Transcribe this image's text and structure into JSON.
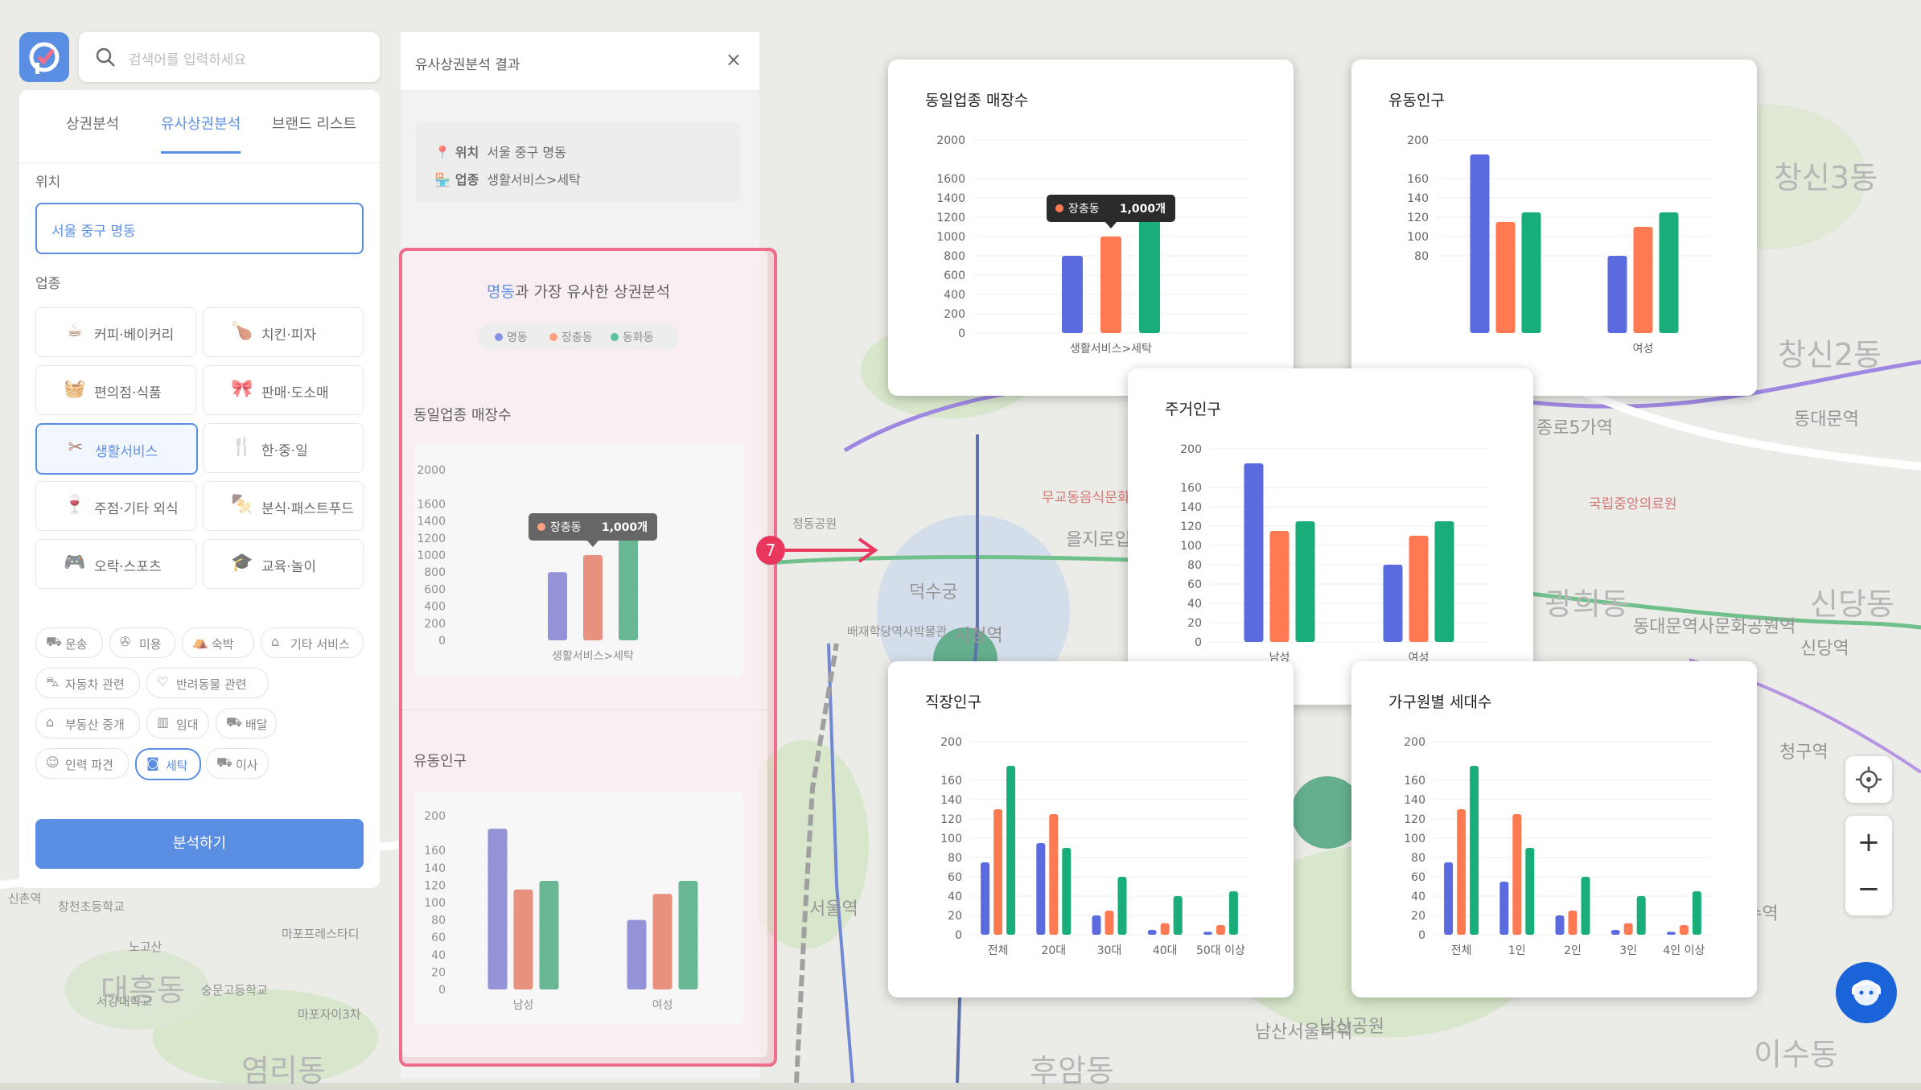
{
  "map": {
    "labels": [
      {
        "text": "창신3동",
        "x": 2205,
        "y": 190,
        "cls": "big"
      },
      {
        "text": "창신2동",
        "x": 2210,
        "y": 410,
        "cls": "big"
      },
      {
        "text": "신당동",
        "x": 2250,
        "y": 720,
        "cls": "big"
      },
      {
        "text": "광희동",
        "x": 1920,
        "y": 720,
        "cls": "big"
      },
      {
        "text": "후암동",
        "x": 1280,
        "y": 1300,
        "cls": "big"
      },
      {
        "text": "대흥동",
        "x": 125,
        "y": 1200,
        "cls": "big"
      },
      {
        "text": "염리동",
        "x": 300,
        "y": 1300,
        "cls": "big"
      },
      {
        "text": "이수동",
        "x": 2180,
        "y": 1280,
        "cls": "big"
      },
      {
        "text": "덕수궁",
        "x": 1130,
        "y": 718,
        "cls": ""
      },
      {
        "text": "종로5가역",
        "x": 1910,
        "y": 514,
        "cls": ""
      },
      {
        "text": "동대문역",
        "x": 2230,
        "y": 503,
        "cls": ""
      },
      {
        "text": "신당역",
        "x": 2238,
        "y": 788,
        "cls": ""
      },
      {
        "text": "을지로입구역",
        "x": 1325,
        "y": 653,
        "cls": ""
      },
      {
        "text": "남산서울타워",
        "x": 1560,
        "y": 1265,
        "cls": ""
      },
      {
        "text": "남산공원",
        "x": 1640,
        "y": 1258,
        "cls": ""
      },
      {
        "text": "서울역",
        "x": 1006,
        "y": 1112,
        "cls": ""
      },
      {
        "text": "시청역",
        "x": 1186,
        "y": 772,
        "cls": ""
      },
      {
        "text": "청구역",
        "x": 2212,
        "y": 917,
        "cls": ""
      },
      {
        "text": "약수역",
        "x": 2150,
        "y": 1118,
        "cls": ""
      },
      {
        "text": "동대문역사문화공원역",
        "x": 2030,
        "y": 761,
        "cls": ""
      },
      {
        "text": "국립중앙의료원",
        "x": 1975,
        "y": 612,
        "cls": "red"
      },
      {
        "text": "무교동음식문화의거리",
        "x": 1295,
        "y": 604,
        "cls": "red"
      },
      {
        "text": "정동공원",
        "x": 985,
        "y": 640,
        "cls": "small"
      },
      {
        "text": "배재학당역사박물관",
        "x": 1053,
        "y": 774,
        "cls": "small"
      },
      {
        "text": "마포프레스타디",
        "x": 350,
        "y": 1150,
        "cls": "small"
      },
      {
        "text": "노고산",
        "x": 160,
        "y": 1166,
        "cls": "small"
      },
      {
        "text": "숭문고등학교",
        "x": 250,
        "y": 1220,
        "cls": "small"
      },
      {
        "text": "마포자이3차",
        "x": 370,
        "y": 1250,
        "cls": "small"
      },
      {
        "text": "서강대학교",
        "x": 120,
        "y": 1234,
        "cls": "small"
      },
      {
        "text": "신촌역",
        "x": 10,
        "y": 1106,
        "cls": "small"
      },
      {
        "text": "창천초등학교",
        "x": 72,
        "y": 1116,
        "cls": "small"
      }
    ]
  },
  "search": {
    "placeholder": "검색어를 입력하세요"
  },
  "panel": {
    "tabs": [
      "상권분석",
      "유사상권분석",
      "브랜드 리스트"
    ],
    "location_label": "위치",
    "location_value": "서울 중구 명동",
    "industry_label": "업종",
    "categories": [
      {
        "icon": "coffee-cup-icon",
        "glyph": "☕",
        "label": "커피·베이커리"
      },
      {
        "icon": "chicken-icon",
        "glyph": "🍗",
        "label": "치킨·피자"
      },
      {
        "icon": "shopping-basket-icon",
        "glyph": "🧺",
        "label": "편의점·식품"
      },
      {
        "icon": "gift-icon",
        "glyph": "🎀",
        "label": "판매·도소매"
      },
      {
        "icon": "scissors-icon",
        "glyph": "✂",
        "label": "생활서비스"
      },
      {
        "icon": "cutlery-icon",
        "glyph": "🍴",
        "label": "한·중·일"
      },
      {
        "icon": "bottle-icon",
        "glyph": "🍷",
        "label": "주점·기타 외식"
      },
      {
        "icon": "snack-icon",
        "glyph": "🍢",
        "label": "분식·패스트푸드"
      },
      {
        "icon": "gamepad-icon",
        "glyph": "🎮",
        "label": "오락·스포츠"
      },
      {
        "icon": "graduation-cap-icon",
        "glyph": "🎓",
        "label": "교육·놀이"
      }
    ],
    "chips": [
      {
        "icon": "truck-icon",
        "glyph": "⛟",
        "label": "운송"
      },
      {
        "icon": "hair-dryer-icon",
        "glyph": "✇",
        "label": "미용"
      },
      {
        "icon": "bed-icon",
        "glyph": "⛺",
        "label": "숙박"
      },
      {
        "icon": "chart-icon",
        "glyph": "⌂",
        "label": "기타 서비스"
      },
      {
        "icon": "car-icon",
        "glyph": "⛍",
        "label": "자동차 관련"
      },
      {
        "icon": "paw-icon",
        "glyph": "♡",
        "label": "반려동물 관련"
      },
      {
        "icon": "house-icon",
        "glyph": "⌂",
        "label": "부동산 중개"
      },
      {
        "icon": "building-icon",
        "glyph": "▥",
        "label": "임대"
      },
      {
        "icon": "delivery-icon",
        "glyph": "⛟",
        "label": "배달"
      },
      {
        "icon": "person-icon",
        "glyph": "☺",
        "label": "인력 파견"
      },
      {
        "icon": "washing-machine-icon",
        "glyph": "◙",
        "label": "세탁"
      },
      {
        "icon": "moving-truck-icon",
        "glyph": "⛟",
        "label": "이사"
      }
    ],
    "analyze_label": "분석하기"
  },
  "result": {
    "title": "유사상권분석 결과",
    "close": "×",
    "location_key": "위치",
    "location_value": "서울 중구 명동",
    "industry_key": "업종",
    "industry_value": "생활서비스>세탁",
    "headline_place": "명동",
    "headline_rest": "과 가장 유사한 상권분석",
    "legend": [
      "명동",
      "장충동",
      "동화동"
    ],
    "section1": "동일업종 매장수",
    "section2": "유동인구"
  },
  "callout": "7",
  "colors": {
    "s1": "#5b6bdf",
    "s2": "#ff7a52",
    "s3": "#19ad7a",
    "accent": "#1b63d8",
    "highlight": "#e8365d"
  },
  "tooltip": {
    "name": "장충동",
    "value": "1,000개"
  },
  "chart_data": [
    {
      "id": "stores",
      "type": "bar",
      "title": "동일업종 매장수",
      "categories": [
        "생활서비스>세탁"
      ],
      "series": [
        {
          "name": "명동",
          "values": [
            800
          ]
        },
        {
          "name": "장충동",
          "values": [
            1000
          ]
        },
        {
          "name": "동화동",
          "values": [
            1300
          ]
        }
      ],
      "ylim": [
        0,
        2000
      ],
      "yticks": [
        0,
        200,
        400,
        600,
        800,
        1000,
        1200,
        1400,
        1600,
        2000
      ]
    },
    {
      "id": "floating",
      "type": "bar",
      "title": "유동인구",
      "categories": [
        "여성"
      ],
      "series": [
        {
          "name": "명동",
          "values": [
            185,
            80
          ]
        },
        {
          "name": "장충동",
          "values": [
            115,
            110
          ]
        },
        {
          "name": "동화동",
          "values": [
            125,
            125
          ]
        }
      ],
      "categories_full": [
        "",
        "여성"
      ],
      "ylim": [
        0,
        200
      ],
      "yticks": [
        80,
        100,
        120,
        140,
        160,
        200
      ]
    },
    {
      "id": "resident",
      "type": "bar",
      "title": "주거인구",
      "categories": [
        "남성",
        "여성"
      ],
      "series": [
        {
          "name": "명동",
          "values": [
            185,
            80
          ]
        },
        {
          "name": "장충동",
          "values": [
            115,
            110
          ]
        },
        {
          "name": "동화동",
          "values": [
            125,
            125
          ]
        }
      ],
      "ylim": [
        0,
        200
      ],
      "yticks": [
        0,
        20,
        40,
        60,
        80,
        100,
        120,
        140,
        160,
        200
      ]
    },
    {
      "id": "workers",
      "type": "bar",
      "title": "직장인구",
      "categories": [
        "전체",
        "20대",
        "30대",
        "40대",
        "50대 이상"
      ],
      "series": [
        {
          "name": "명동",
          "values": [
            75,
            95,
            20,
            5,
            3
          ]
        },
        {
          "name": "장충동",
          "values": [
            130,
            125,
            25,
            12,
            10
          ]
        },
        {
          "name": "동화동",
          "values": [
            175,
            90,
            60,
            40,
            45
          ]
        }
      ],
      "ylim": [
        0,
        200
      ],
      "yticks": [
        0,
        20,
        40,
        60,
        80,
        100,
        120,
        140,
        160,
        200
      ]
    },
    {
      "id": "households",
      "type": "bar",
      "title": "가구원별 세대수",
      "categories": [
        "전체",
        "1인",
        "2인",
        "3인",
        "4인 이상"
      ],
      "series": [
        {
          "name": "명동",
          "values": [
            75,
            55,
            20,
            5,
            3
          ]
        },
        {
          "name": "장충동",
          "values": [
            130,
            125,
            25,
            12,
            10
          ]
        },
        {
          "name": "동화동",
          "values": [
            175,
            90,
            60,
            40,
            45
          ]
        }
      ],
      "ylim": [
        0,
        200
      ],
      "yticks": [
        0,
        20,
        40,
        60,
        80,
        100,
        120,
        140,
        160,
        200
      ]
    },
    {
      "id": "panel-stores",
      "type": "bar",
      "title": "동일업종 매장수",
      "categories": [
        "생활서비스>세탁"
      ],
      "series": [
        {
          "name": "명동",
          "values": [
            800
          ]
        },
        {
          "name": "장충동",
          "values": [
            1000
          ]
        },
        {
          "name": "동화동",
          "values": [
            1300
          ]
        }
      ],
      "ylim": [
        0,
        2000
      ],
      "yticks": [
        0,
        200,
        400,
        600,
        800,
        1000,
        1200,
        1400,
        1600,
        2000
      ]
    },
    {
      "id": "panel-floating",
      "type": "bar",
      "title": "유동인구",
      "categories": [
        "남성",
        "여성"
      ],
      "series": [
        {
          "name": "명동",
          "values": [
            185,
            80
          ]
        },
        {
          "name": "장충동",
          "values": [
            115,
            110
          ]
        },
        {
          "name": "동화동",
          "values": [
            125,
            125
          ]
        }
      ],
      "ylim": [
        0,
        200
      ],
      "yticks": [
        0,
        20,
        40,
        60,
        80,
        100,
        120,
        140,
        160,
        200
      ]
    }
  ]
}
